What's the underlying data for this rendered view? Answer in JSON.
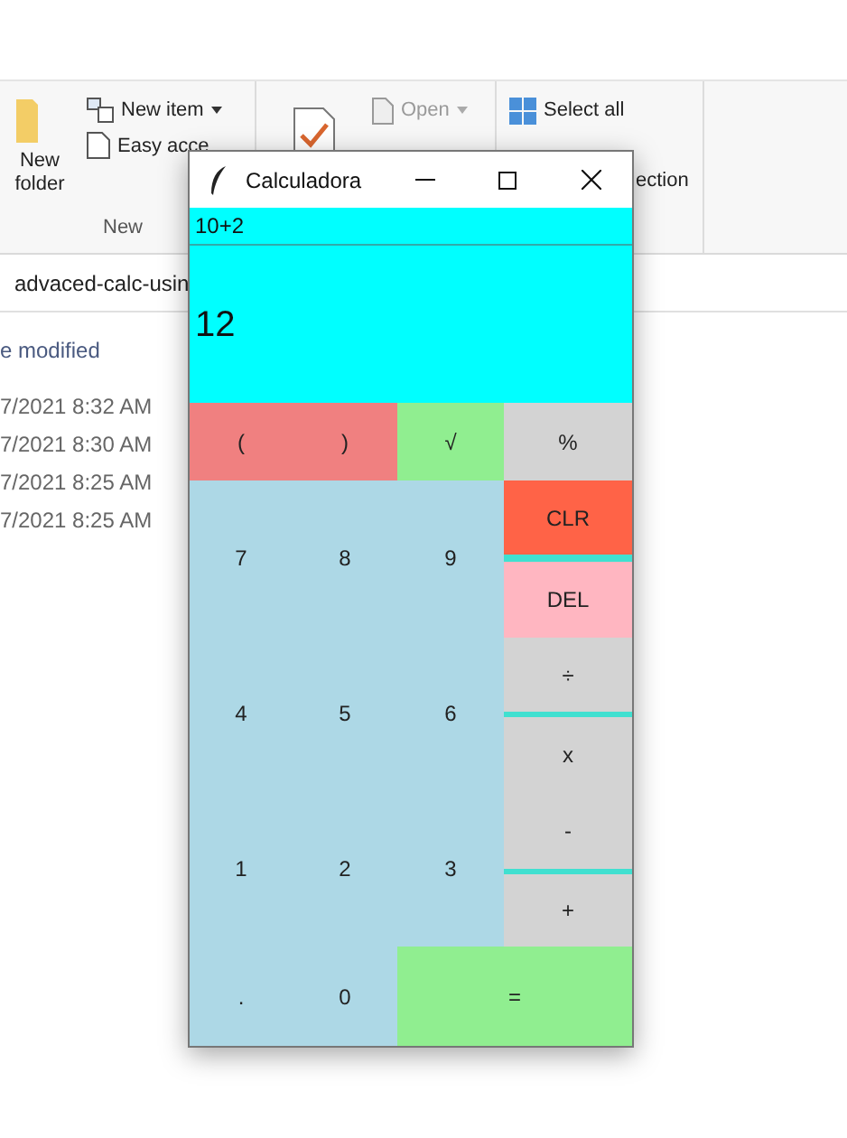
{
  "explorer": {
    "ribbon": {
      "new_group": {
        "new_folder": "New folder",
        "new_item": "New item",
        "easy_access": "Easy acce",
        "label": "New"
      },
      "open_group": {
        "open": "Open",
        "open_disabled": true
      },
      "select_group": {
        "select_all": "Select all",
        "invert": "ection"
      }
    },
    "address": "advaced-calc-usin",
    "column_header": "e modified",
    "dates": [
      "7/2021 8:32 AM",
      "7/2021 8:30 AM",
      "7/2021 8:25 AM",
      "7/2021 8:25 AM"
    ]
  },
  "calculator": {
    "title": "Calculadora",
    "expression": "10+2",
    "result": "12",
    "top_row": [
      {
        "label": "(",
        "kind": "paren"
      },
      {
        "label": ")",
        "kind": "paren"
      },
      {
        "label": "√",
        "kind": "func"
      },
      {
        "label": "%",
        "kind": "op"
      }
    ],
    "digits": [
      {
        "label": "7",
        "kind": "digit"
      },
      {
        "label": "8",
        "kind": "digit"
      },
      {
        "label": "9",
        "kind": "digit"
      },
      {
        "label": "4",
        "kind": "digit"
      },
      {
        "label": "5",
        "kind": "digit"
      },
      {
        "label": "6",
        "kind": "digit"
      },
      {
        "label": "1",
        "kind": "digit"
      },
      {
        "label": "2",
        "kind": "digit"
      },
      {
        "label": "3",
        "kind": "digit"
      }
    ],
    "side": [
      {
        "label": "CLR",
        "kind": "clear"
      },
      {
        "label": "DEL",
        "kind": "delete"
      },
      {
        "label": "÷",
        "kind": "op"
      },
      {
        "label": "x",
        "kind": "op"
      },
      {
        "label": "-",
        "kind": "op"
      },
      {
        "label": "+",
        "kind": "op"
      }
    ],
    "bottom_row": [
      {
        "label": ".",
        "kind": "digit"
      },
      {
        "label": "0",
        "kind": "digit"
      },
      {
        "label": "=",
        "kind": "equals"
      }
    ]
  }
}
